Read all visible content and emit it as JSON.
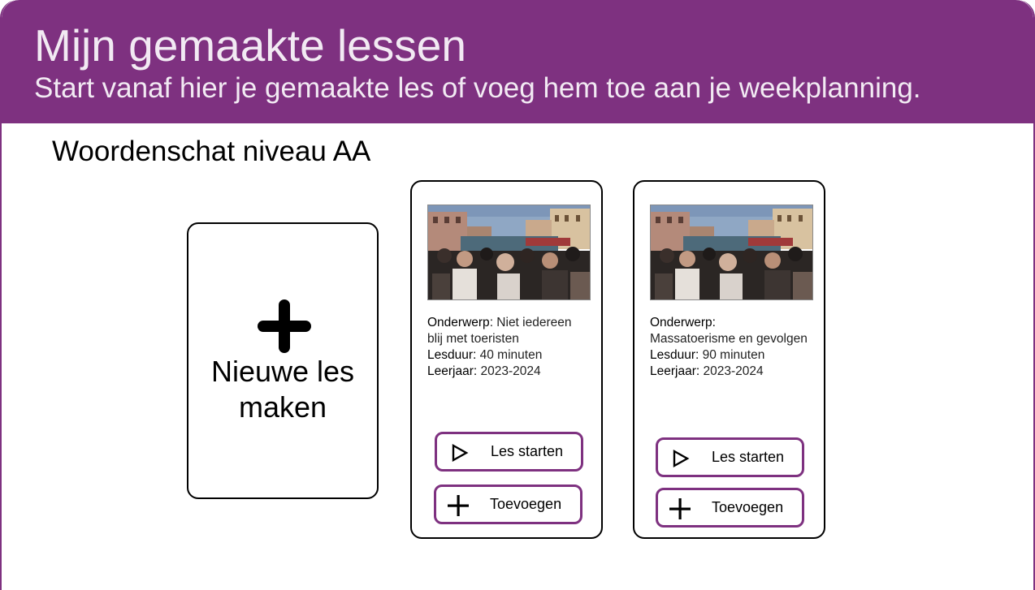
{
  "header": {
    "title": "Mijn gemaakte lessen",
    "subtitle": "Start vanaf hier je gemaakte les of voeg hem toe aan je weekplanning."
  },
  "section": {
    "title": "Woordenschat niveau AA"
  },
  "new_lesson": {
    "label_line1": "Nieuwe les",
    "label_line2": "maken",
    "icon": "plus-icon"
  },
  "lessons": [
    {
      "subject_label": "Onderwerp",
      "subject_value": ": Niet iedereen blij met toeristen",
      "duration_label": "Lesduur:",
      "duration_value": " 40 minuten",
      "year_label": "Leerjaar:",
      "year_value": " 2023-2024",
      "start_label": "Les starten",
      "add_label": "Toevoegen"
    },
    {
      "subject_label": "Onderwerp:",
      "subject_value": "Massatoerisme  en gevolgen",
      "duration_label": "Lesduur:",
      "duration_value": " 90 minuten",
      "year_label": "Leerjaar:",
      "year_value": " 2023-2024",
      "start_label": "Les starten",
      "add_label": "Toevoegen"
    }
  ],
  "colors": {
    "brand": "#7e3180",
    "header_text": "#f2eaf3"
  },
  "icons": {
    "start": "play-icon",
    "add": "plus-icon",
    "thumbnail": "lesson-photo-venice-crowd"
  }
}
